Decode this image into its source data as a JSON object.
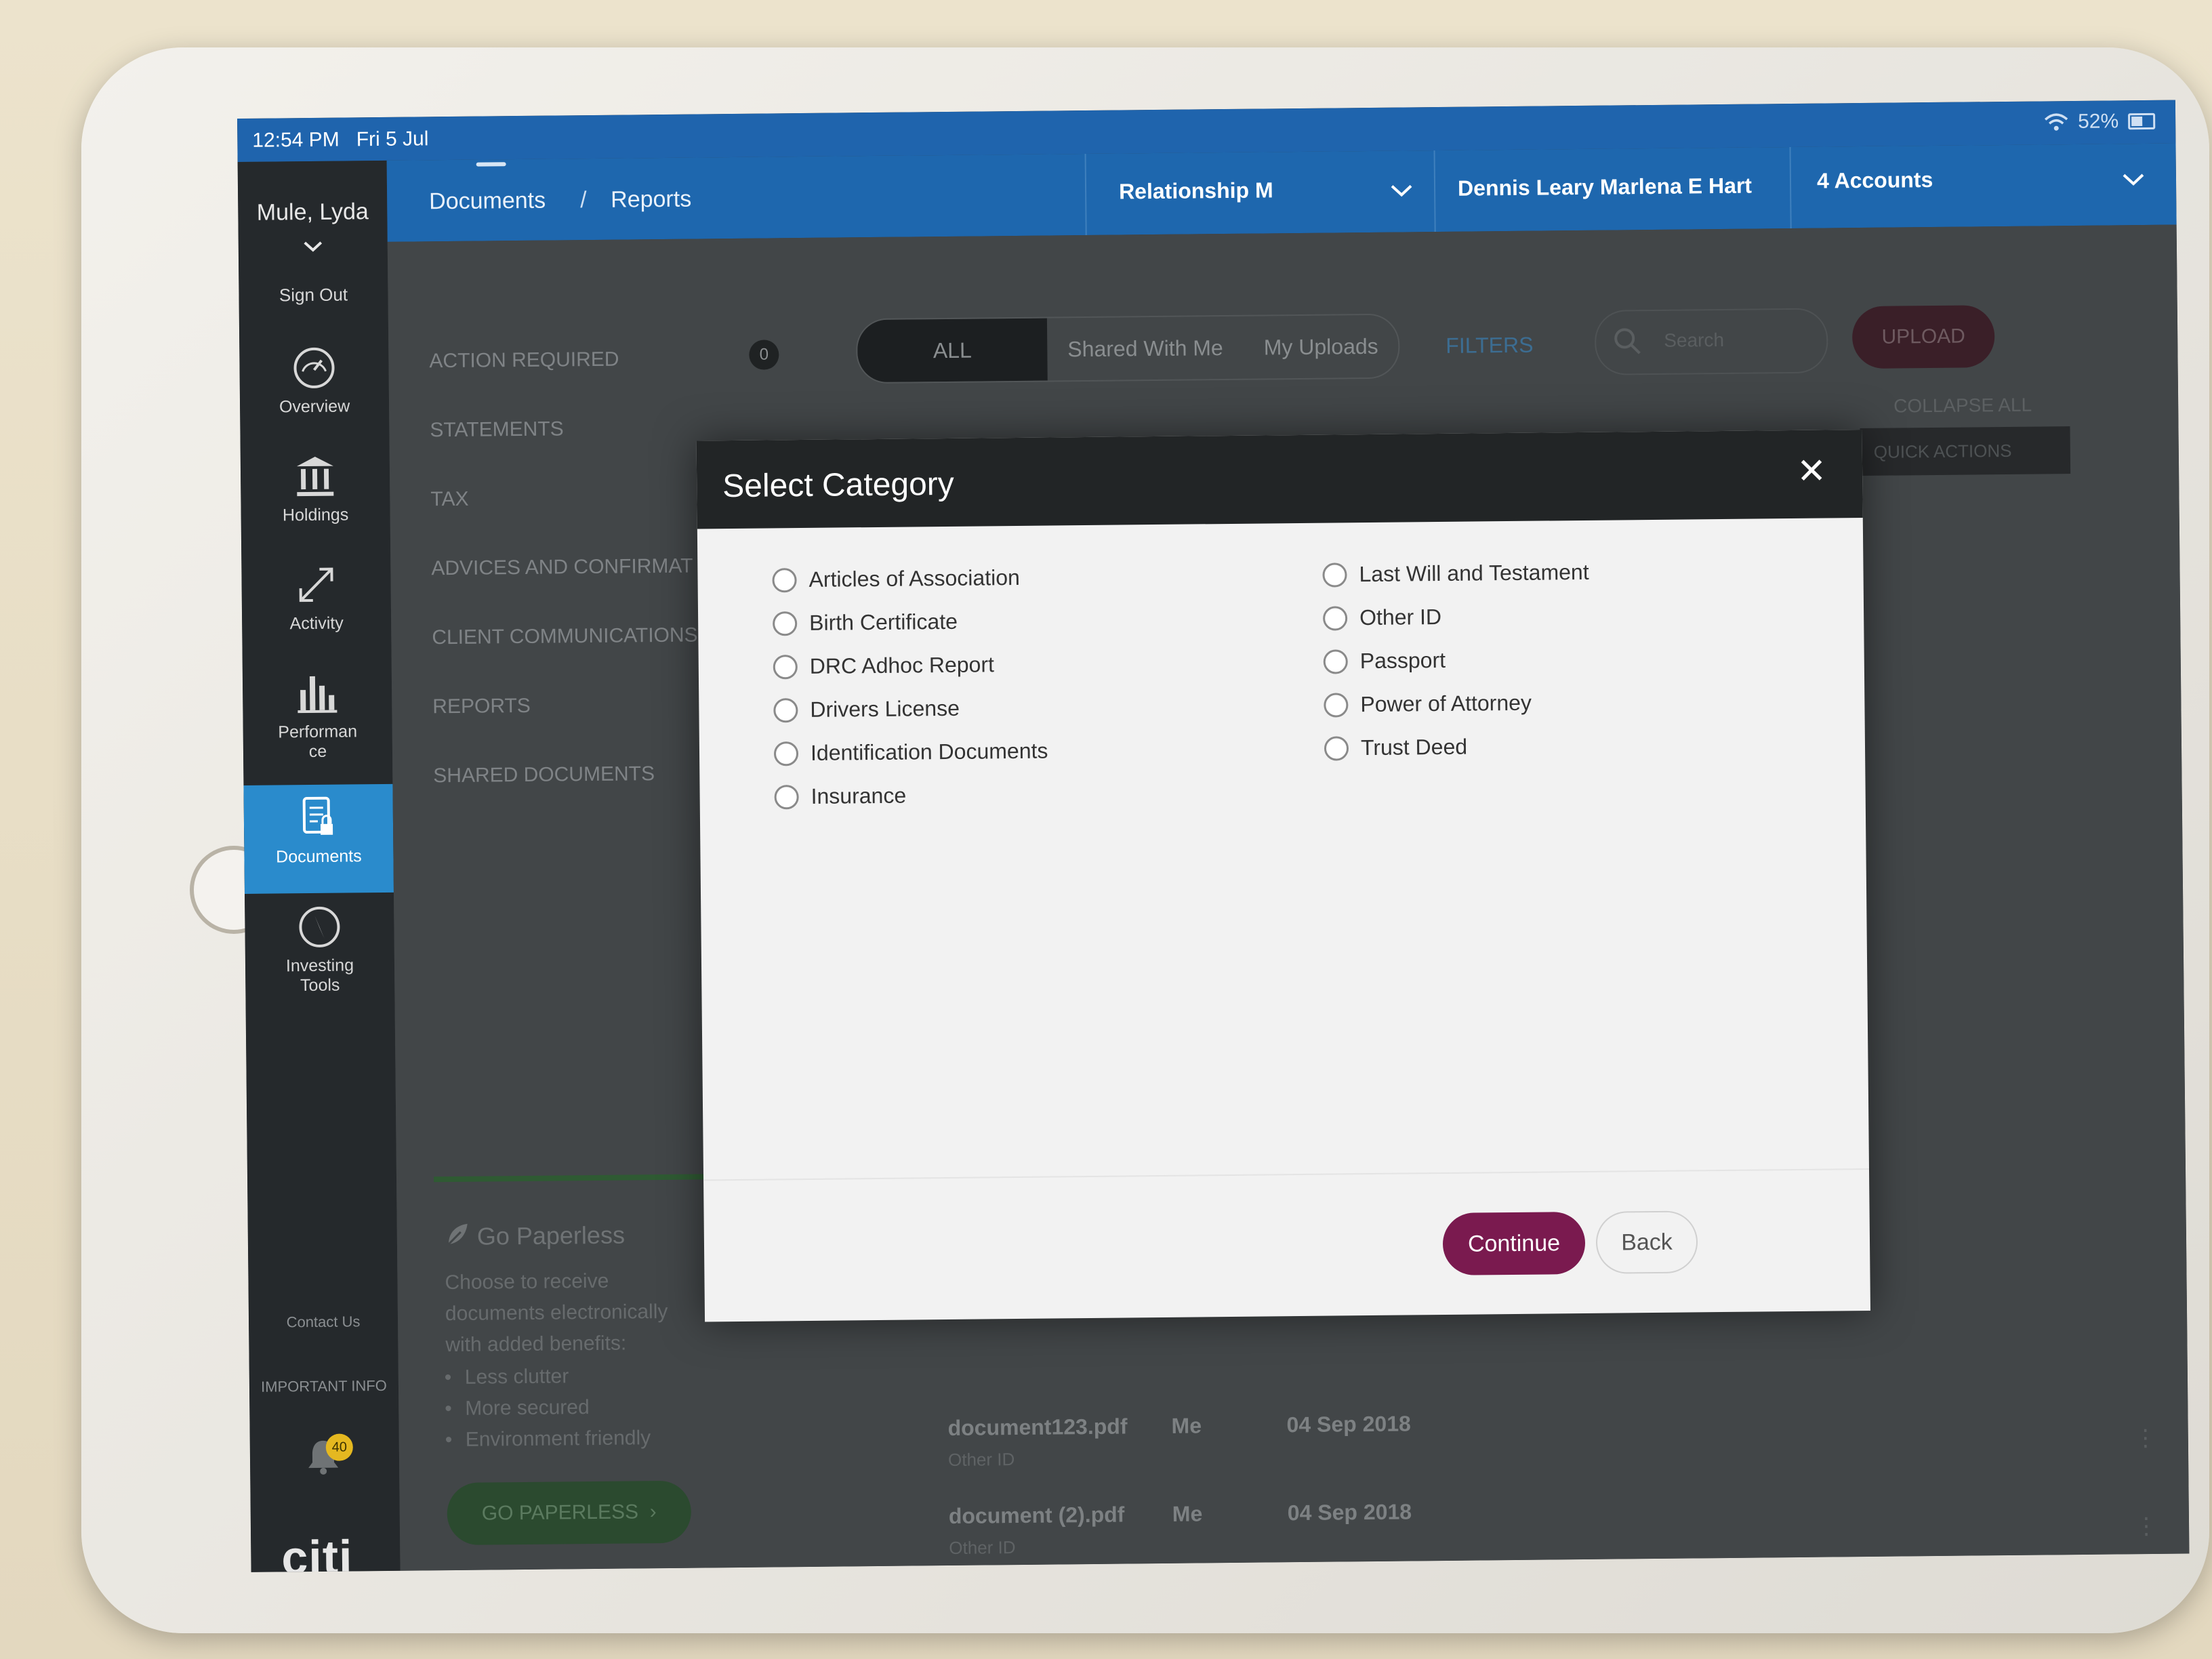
{
  "statusbar": {
    "time": "12:54 PM",
    "date": "Fri 5 Jul",
    "battery": "52%"
  },
  "sidebar": {
    "user": "Mule, Lyda",
    "sign_out": "Sign Out",
    "items": [
      {
        "label": "Overview",
        "icon": "speedometer-icon"
      },
      {
        "label": "Holdings",
        "icon": "bank-icon"
      },
      {
        "label": "Activity",
        "icon": "arrows-icon"
      },
      {
        "label": "Performan ce",
        "icon": "bar-chart-icon"
      },
      {
        "label": "Documents",
        "icon": "document-lock-icon",
        "active": true
      },
      {
        "label": "Investing Tools",
        "icon": "compass-icon"
      }
    ],
    "contact": "Contact Us",
    "important": "IMPORTANT INFO",
    "notification_count": "40",
    "brand": "citi"
  },
  "appbar": {
    "crumb1": "Documents",
    "separator": "/",
    "crumb2": "Reports",
    "relationship": "Relationship M",
    "client": "Dennis Leary Marlena E Hart",
    "accounts": "4 Accounts"
  },
  "content": {
    "categories": [
      "ACTION REQUIRED",
      "STATEMENTS",
      "TAX",
      "ADVICES AND CONFIRMAT",
      "CLIENT COMMUNICATIONS",
      "REPORTS",
      "SHARED DOCUMENTS"
    ],
    "action_count": "0",
    "segments": [
      "ALL",
      "Shared With Me",
      "My Uploads"
    ],
    "filters": "FILTERS",
    "search_placeholder": "Search",
    "upload": "UPLOAD",
    "collapse_all": "COLLAPSE ALL",
    "quick_actions": "QUICK ACTIONS",
    "paperless": {
      "title": "Go Paperless",
      "line1": "Choose to receive",
      "line2": "documents electronically",
      "line3": "with added benefits:",
      "bullets": [
        "Less clutter",
        "More secured",
        "Environment friendly"
      ],
      "button": "GO PAPERLESS"
    },
    "documents": [
      {
        "name": "document123.pdf",
        "type": "Other ID",
        "owner": "Me",
        "date": "04 Sep 2018"
      },
      {
        "name": "document (2).pdf",
        "type": "Other ID",
        "owner": "Me",
        "date": "04 Sep 2018"
      }
    ]
  },
  "modal": {
    "title": "Select Category",
    "close": "✕",
    "left_options": [
      "Articles of Association",
      "Birth Certificate",
      "DRC Adhoc Report",
      "Drivers License",
      "Identification Documents",
      "Insurance"
    ],
    "right_options": [
      "Last Will and Testament",
      "Other ID",
      "Passport",
      "Power of Attorney",
      "Trust Deed"
    ],
    "continue": "Continue",
    "back": "Back"
  },
  "colors": {
    "accent": "#1e67ae",
    "active_nav": "#2a8bcc",
    "continue_button": "#7a1a4f",
    "modal_header": "#222526"
  }
}
